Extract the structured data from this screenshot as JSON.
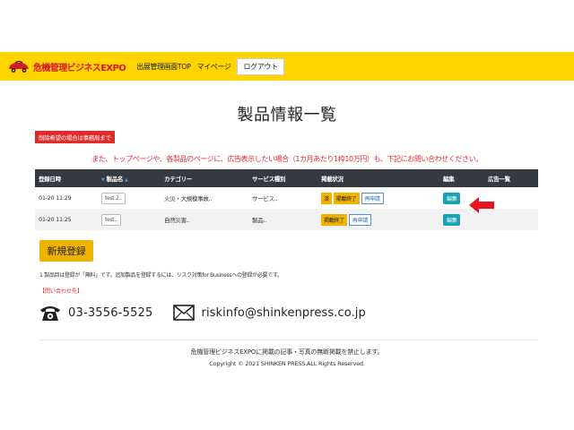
{
  "navbar": {
    "brand_text": "危機管理ビジネスEXPO",
    "links": [
      "出展管理画面TOP",
      "マイページ"
    ],
    "logout_label": "ログアウト",
    "accent_color": "#ffd400"
  },
  "page": {
    "title": "製品情報一覧",
    "delete_notice": "削除希望の場合は事務局まで",
    "ad_notice": "また、トップページや、各製品のページに、広告表示したい場合（1カ月あたり1枠10万円）も、下記にお問い合わせください。"
  },
  "table": {
    "headers": [
      "登録日時",
      "製品名",
      "カテゴリー",
      "サービス種別",
      "掲載状況",
      "編集",
      "広告一覧"
    ],
    "rows": [
      {
        "date": "01-20 11:29",
        "name": "test 2..",
        "category": "火災・大規模事故..",
        "service": "サービス..",
        "status_badges": [
          "済",
          "掲載終了"
        ],
        "status_link": "再申請",
        "edit": "編集"
      },
      {
        "date": "01-20 11:25",
        "name": "test..",
        "category": "自然災害..",
        "service": "製品..",
        "status_badges": [
          "掲載終了"
        ],
        "status_link": "再申請",
        "edit": "編集"
      }
    ]
  },
  "register_button": "新規登録",
  "register_note": "1 製品目は登録が「無料」です。追加製品を登録するには、リスク対策for Businessへの登録が必要です。",
  "contact": {
    "heading": "【問い合わせ先】",
    "phone": "03-3556-5525",
    "email": "riskinfo@shinkenpress.co.jp"
  },
  "footer": {
    "line1": "危機管理ビジネスEXPOに掲載の記事・写真の無断掲載を禁止します。",
    "line2": "Copyright © 2021 SHINKEN PRESS.ALL Rights Reserved."
  },
  "icons": {
    "brand_logo": "car-logo-icon",
    "sort": "sort-triangle-icon",
    "arrow": "red-arrow-left-icon",
    "phone": "phone-icon",
    "mail": "mail-icon"
  }
}
